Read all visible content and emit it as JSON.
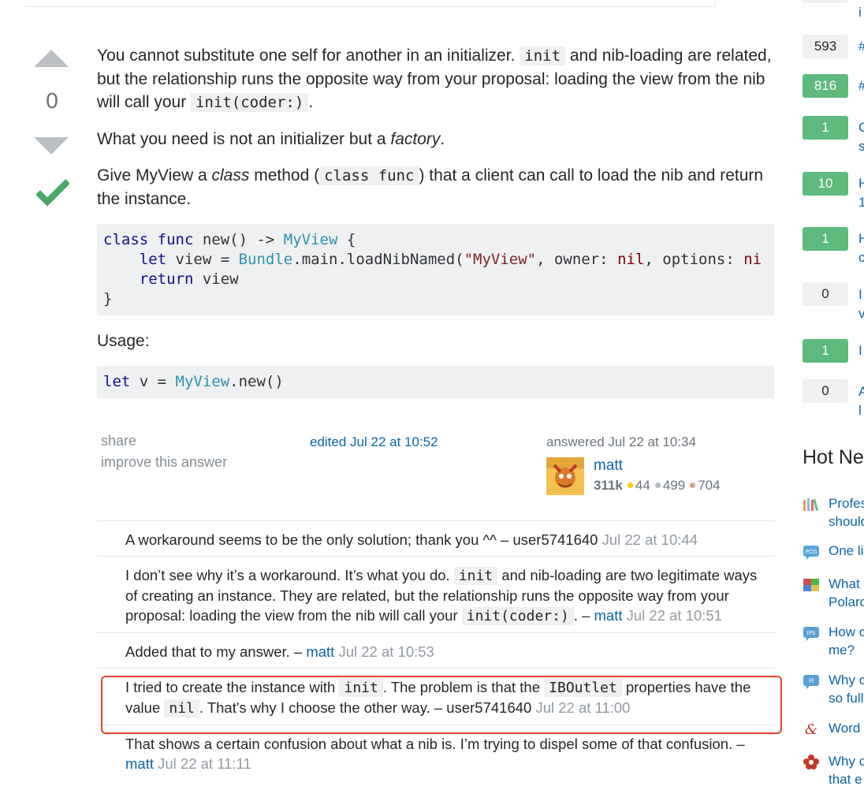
{
  "vote": {
    "count": "0"
  },
  "post": {
    "p1_a": "You cannot substitute one self for another in an initializer.",
    "p1_code1": "init",
    "p1_b": "and nib-loading are related, but the relationship runs the opposite way from your proposal: loading the view from the nib will call your",
    "p1_code2": "init(coder:)",
    "p1_c": ".",
    "p2_a": "What you need is not an initializer but a",
    "p2_em": "factory",
    "p2_b": ".",
    "p3_a": "Give MyView a",
    "p3_em": "class",
    "p3_b": "method (",
    "p3_code": "class func",
    "p3_c": ") that a client can call to load the nib and return the instance.",
    "code1_line1_kw": "class func",
    "code1_line1_fn": "new() -> ",
    "code1_line1_ty": "MyView",
    "code1_line1_end": " {",
    "code1_line2_kw": "let",
    "code1_line2_a": " view = ",
    "code1_line2_ty": "Bundle",
    "code1_line2_b": ".main.loadNibNamed(",
    "code1_line2_str": "\"MyView\"",
    "code1_line2_c": ", owner: ",
    "code1_line2_nil": "nil",
    "code1_line2_d": ", options: ",
    "code1_line2_nil2": "ni",
    "code1_line3_kw": "return",
    "code1_line3_a": " view",
    "code1_line4": "}",
    "usage_label": "Usage:",
    "code2_kw": "let",
    "code2_a": " v = ",
    "code2_ty": "MyView",
    "code2_b": ".new()"
  },
  "menu": {
    "share": "share",
    "improve": "improve this answer"
  },
  "edited": "edited Jul 22 at 10:52",
  "answered": "answered Jul 22 at 10:34",
  "user": {
    "name": "matt",
    "rep": "311k",
    "gold": "44",
    "silver": "499",
    "bronze": "704"
  },
  "comments": [
    {
      "text": "A workaround seems to be the only solution; thank you ^^ –",
      "user": "user5741640",
      "date": "Jul 22 at 10:44"
    },
    {
      "text_a": "I don’t see why it’s a workaround. It’s what you do.",
      "code1": "init",
      "text_b": "and nib-loading are two legitimate ways of creating an instance. They are related, but the relationship runs the opposite way from your proposal: loading the view from the nib will call your",
      "code2": "init(coder:)",
      "text_c": ". –",
      "user": "matt",
      "date": "Jul 22 at 10:51"
    },
    {
      "text": "Added that to my answer. –",
      "user": "matt",
      "date": "Jul 22 at 10:53"
    },
    {
      "text_a": "I tried to create the instance with",
      "code1": "init",
      "text_b": ". The problem is that the",
      "code2": "IBOutlet",
      "text_c": "properties have the value",
      "code3": "nil",
      "text_d": ". That's why I choose the other way. –",
      "user": "user5741640",
      "date": "Jul 22 at 11:00"
    },
    {
      "text": "That shows a certain confusion about what a nib is. I’m trying to dispel some of that confusion. –",
      "user": "matt",
      "date": "Jul 22 at 11:11"
    }
  ],
  "sidebar": {
    "linked": [
      {
        "score": "",
        "text": "i"
      },
      {
        "score": "593",
        "text": "#"
      },
      {
        "score": "816",
        "text": "#"
      },
      {
        "score": "1",
        "text": "C"
      },
      {
        "score": "10",
        "text": "H"
      },
      {
        "score": "1",
        "text": "H"
      },
      {
        "score": "0",
        "text": "I"
      },
      {
        "score": "1",
        "text": "I"
      },
      {
        "score": "0",
        "text": "A"
      }
    ],
    "linked_line2": [
      "s",
      "1",
      "c",
      "v",
      "l"
    ],
    "hot_title": "Hot Ne",
    "hot": [
      {
        "line1": "Profes",
        "line2": "should"
      },
      {
        "line1": "One li",
        "line2": ""
      },
      {
        "line1": "What",
        "line2": "Polaro"
      },
      {
        "line1": "How c",
        "line2": "me?"
      },
      {
        "line1": "Why c",
        "line2": "so full"
      },
      {
        "line1": "Word",
        "line2": ""
      },
      {
        "line1": "Why c",
        "line2": "that e"
      }
    ]
  }
}
